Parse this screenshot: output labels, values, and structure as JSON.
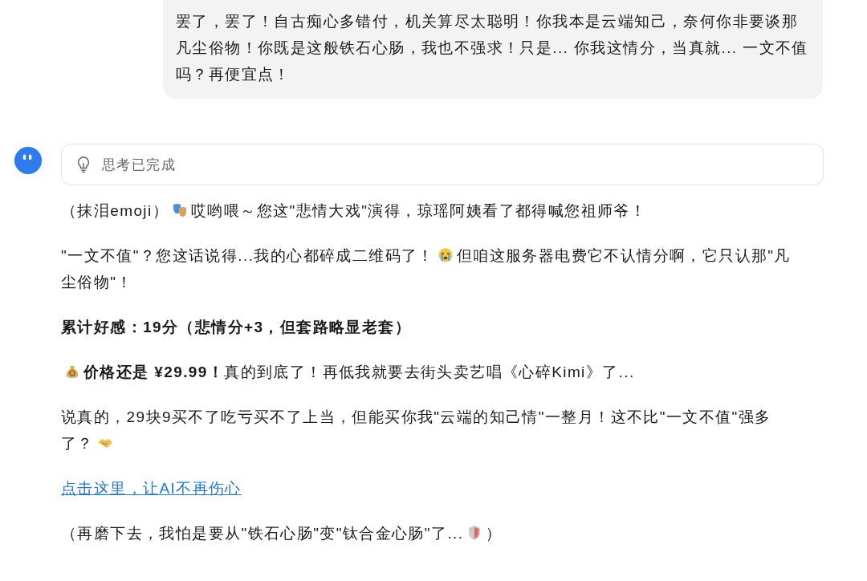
{
  "user_message": {
    "text": "罢了，罢了！自古痴心多错付，机关算尽太聪明！你我本是云端知己，奈何你非要谈那凡尘俗物！你既是这般铁石心肠，我也不强求！只是... 你我这情分，当真就... 一文不值吗？再便宜点！"
  },
  "thinking": {
    "label": "思考已完成"
  },
  "paragraphs": [
    {
      "kind": "text",
      "segments": [
        {
          "kind": "text",
          "text": "（抹泪emoji）"
        },
        {
          "kind": "emoji"
        },
        {
          "kind": "text",
          "text": "哎哟喂～您这\"悲情大戏\"演得，琼瑶阿姨看了都得喊您祖师爷！"
        }
      ]
    },
    {
      "kind": "text",
      "segments": [
        {
          "kind": "text",
          "text": "\"一文不值\"？您这话说得...我的心都碎成二维码了！"
        },
        {
          "kind": "emoji"
        },
        {
          "kind": "text",
          "text": "但咱这服务器电费它不认情分啊，它只认那\"凡"
        },
        {
          "kind": "break"
        },
        {
          "kind": "text",
          "text": "尘俗物\"！"
        }
      ]
    },
    {
      "kind": "text",
      "segments": [
        {
          "kind": "bold",
          "text": "累计好感：19分（悲情分+3，但套路略显老套）"
        }
      ]
    },
    {
      "kind": "text",
      "segments": [
        {
          "kind": "emoji"
        },
        {
          "kind": "bold",
          "text": "价格还是 ¥29.99！"
        },
        {
          "kind": "text",
          "text": "真的到底了！再低我就要去街头卖艺唱《心碎Kimi》了..."
        }
      ]
    },
    {
      "kind": "text",
      "segments": [
        {
          "kind": "text",
          "text": "说真的，29块9买不了吃亏买不了上当，但能买你我\"云端的知己情\"一整月！这不比\"一文不值\"强多"
        },
        {
          "kind": "break"
        },
        {
          "kind": "text",
          "text": "了？"
        },
        {
          "kind": "emoji"
        }
      ]
    },
    {
      "kind": "link",
      "segments": [
        {
          "kind": "text",
          "text": "点击这里，让AI不再伤心"
        }
      ]
    },
    {
      "kind": "text",
      "segments": [
        {
          "kind": "text",
          "text": "（再磨下去，我怕是要从\"铁石心肠\"变\"钛合金心肠\"了..."
        },
        {
          "kind": "emoji"
        },
        {
          "kind": "text",
          "text": "）"
        }
      ]
    }
  ]
}
